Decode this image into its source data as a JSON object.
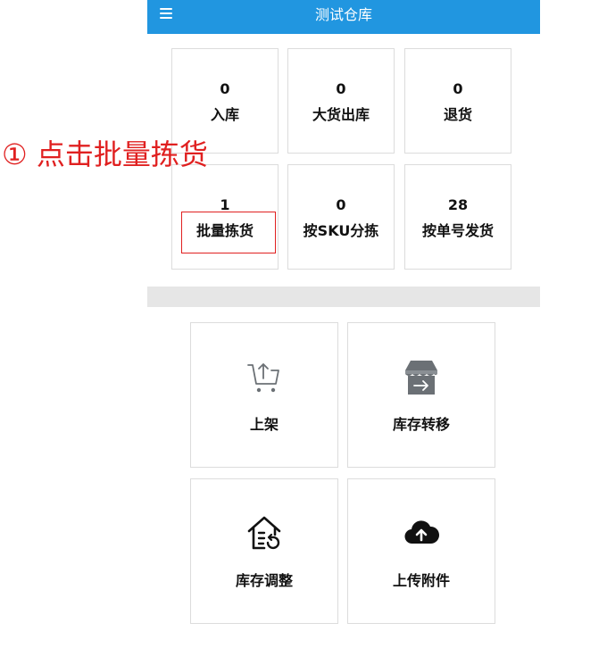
{
  "header": {
    "title": "测试仓库",
    "menu_icon": "hamburger-menu-icon"
  },
  "stats": [
    {
      "count": "0",
      "label": "入库"
    },
    {
      "count": "0",
      "label": "大货出库"
    },
    {
      "count": "0",
      "label": "退货"
    },
    {
      "count": "1",
      "label": "批量拣货"
    },
    {
      "count": "0",
      "label": "按SKU分拣"
    },
    {
      "count": "28",
      "label": "按单号发货"
    }
  ],
  "functions": [
    {
      "label": "上架",
      "icon": "cart-upload-icon"
    },
    {
      "label": "库存转移",
      "icon": "store-transfer-icon"
    },
    {
      "label": "库存调整",
      "icon": "house-adjust-icon"
    },
    {
      "label": "上传附件",
      "icon": "cloud-upload-icon"
    }
  ],
  "annotation": {
    "text": "① 点击批量拣货",
    "color": "#e02020"
  },
  "colors": {
    "header_bg": "#2196e0",
    "icon_gray": "#6b7075",
    "icon_dark": "#111111"
  }
}
